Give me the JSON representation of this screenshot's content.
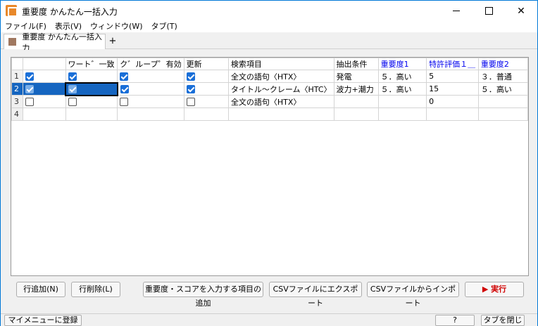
{
  "window": {
    "title": "重要度 かんたん一括入力",
    "controls": {
      "minimize": "",
      "maximize": "",
      "close": "✕"
    }
  },
  "menubar": {
    "items": [
      "ファイル(F)",
      "表示(V)",
      "ウィンドウ(W)",
      "タブ(T)"
    ]
  },
  "tabs": {
    "active": "重要度 かんたん一括入力",
    "add": "+"
  },
  "grid": {
    "columns": [
      "",
      "ワート゛一致",
      "ク゛ループ゜有効",
      "更新",
      "検索項目",
      "抽出条件",
      "重要度1",
      "特許評価１＿",
      "重要度2"
    ],
    "rows": [
      {
        "num": "1",
        "c1": true,
        "c2": true,
        "c3": true,
        "c4": true,
        "search": "全文の語句〈HTX〉",
        "cond": "発電",
        "imp1": "５．高い",
        "score": "5",
        "imp2": "３．普通"
      },
      {
        "num": "2",
        "c1": true,
        "c2": true,
        "c3": true,
        "c4": true,
        "search": "タイトル〜クレーム〈HTC〉",
        "cond": "波力+潮力",
        "imp1": "５．高い",
        "score": "15",
        "imp2": "５．高い"
      },
      {
        "num": "3",
        "c1": false,
        "c2": false,
        "c3": false,
        "c4": false,
        "search": "全文の語句〈HTX〉",
        "cond": "",
        "imp1": "",
        "score": "0",
        "imp2": ""
      },
      {
        "num": "4"
      }
    ]
  },
  "buttons": {
    "add_row": "行追加(N)",
    "delete_row": "行削除(L)",
    "add_item": "重要度・スコアを入力する項目の追加",
    "csv_export": "CSVファイルにエクスポート",
    "csv_import": "CSVファイルからインポート",
    "run": "▶ 実行"
  },
  "statusbar": {
    "register": "マイメニューに登録",
    "help": "?",
    "close_tab": "タブを閉じる"
  },
  "colors": {
    "header_blue": "#0000ee",
    "selection": "#1565c0",
    "run_red": "#d00000"
  }
}
